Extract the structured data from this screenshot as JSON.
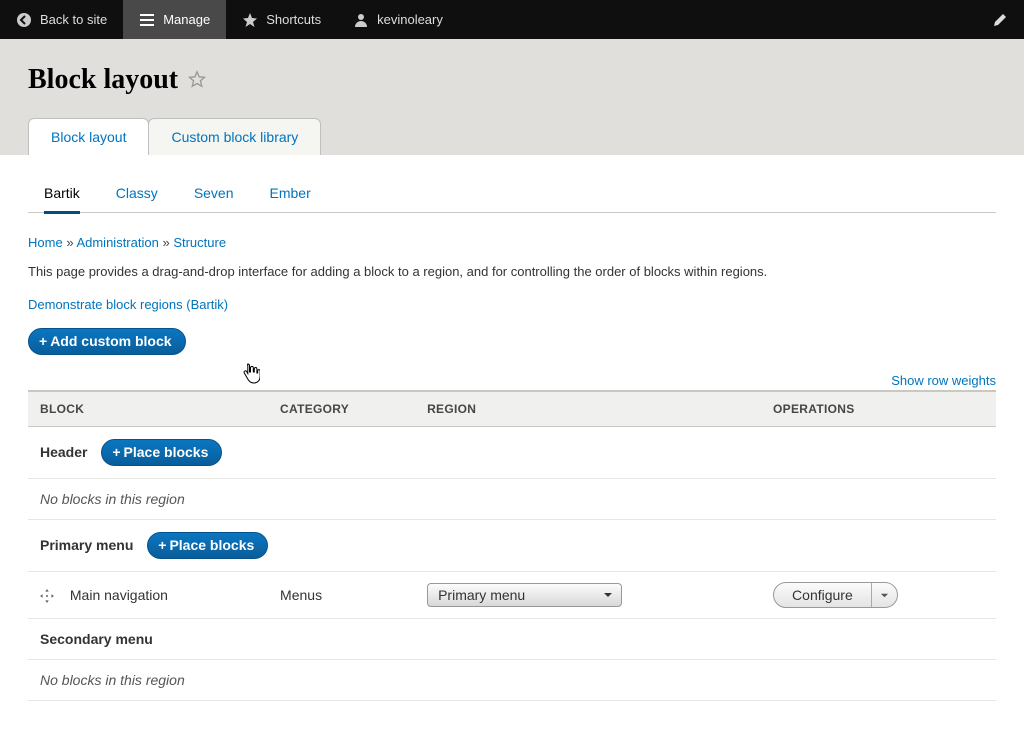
{
  "toolbar": {
    "back": "Back to site",
    "manage": "Manage",
    "shortcuts": "Shortcuts",
    "user": "kevinoleary"
  },
  "page": {
    "title": "Block layout"
  },
  "tabs": {
    "primary": [
      {
        "label": "Block layout",
        "active": true
      },
      {
        "label": "Custom block library",
        "active": false
      }
    ],
    "secondary": [
      {
        "label": "Bartik",
        "active": true
      },
      {
        "label": "Classy",
        "active": false
      },
      {
        "label": "Seven",
        "active": false
      },
      {
        "label": "Ember",
        "active": false
      }
    ]
  },
  "breadcrumb": {
    "home": "Home",
    "admin": "Administration",
    "structure": "Structure",
    "sep": "»"
  },
  "description": "This page provides a drag-and-drop interface for adding a block to a region, and for controlling the order of blocks within regions.",
  "demo_link": "Demonstrate block regions (Bartik)",
  "add_custom": "Add custom block",
  "row_weights": "Show row weights",
  "columns": {
    "block": "BLOCK",
    "category": "CATEGORY",
    "region": "REGION",
    "operations": "OPERATIONS"
  },
  "place_blocks_label": "Place blocks",
  "empty_msg": "No blocks in this region",
  "regions": {
    "header": {
      "label": "Header"
    },
    "primary_menu": {
      "label": "Primary menu",
      "block": {
        "name": "Main navigation",
        "category": "Menus",
        "region_value": "Primary menu",
        "op": "Configure"
      }
    },
    "secondary_menu": {
      "label": "Secondary menu"
    }
  }
}
